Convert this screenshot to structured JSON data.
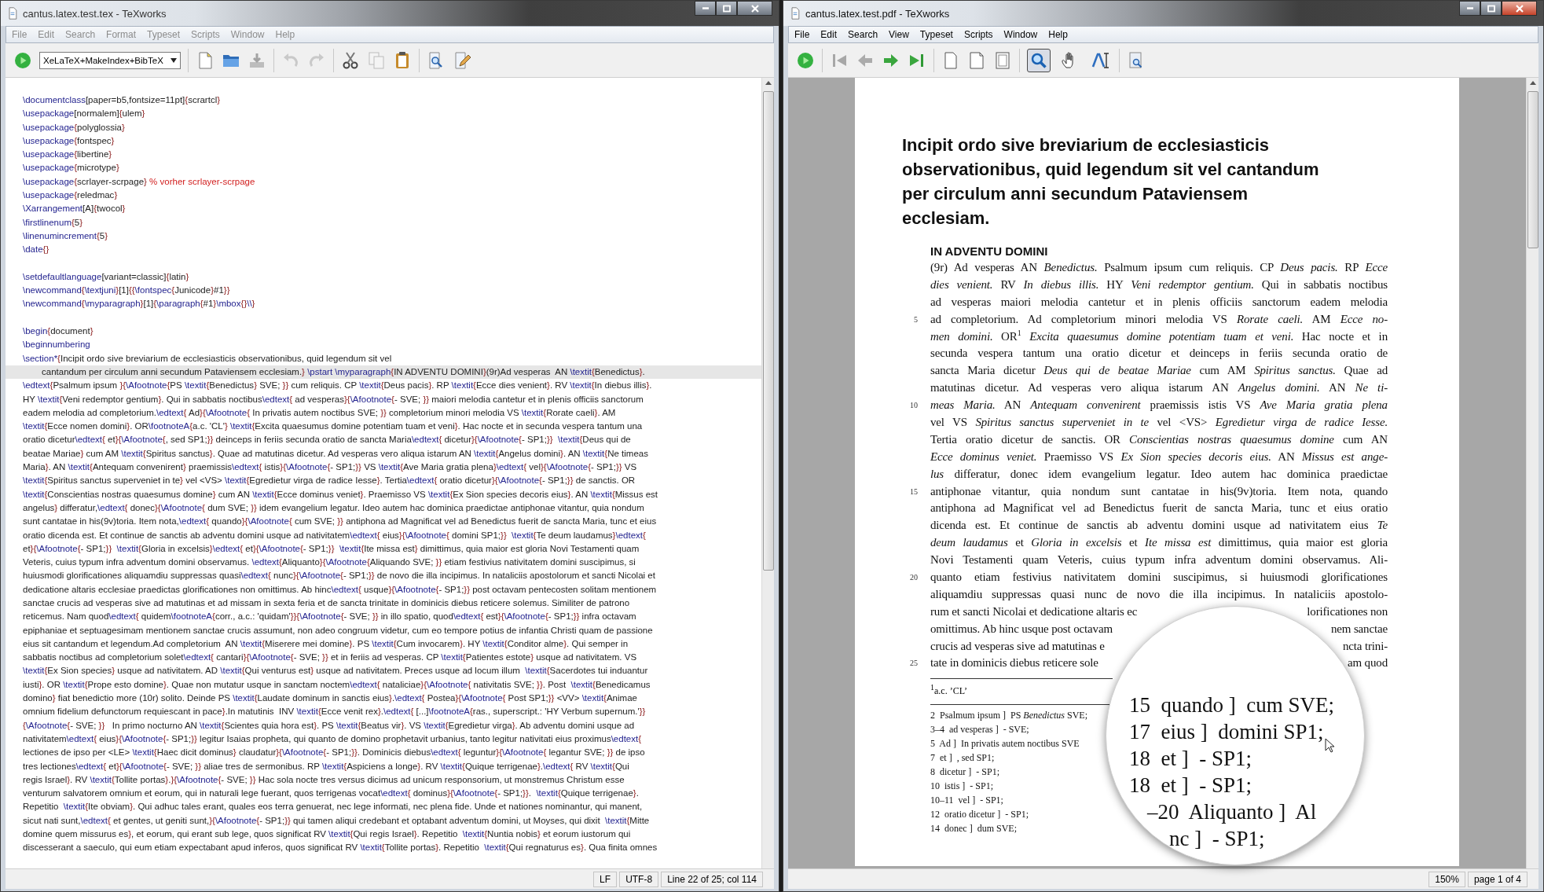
{
  "editor_window": {
    "title": "cantus.latex.test.tex - TeXworks",
    "active": false,
    "menu": [
      "File",
      "Edit",
      "Search",
      "Format",
      "Typeset",
      "Scripts",
      "Window",
      "Help"
    ],
    "typeset_engine": "XeLaTeX+MakeIndex+BibTeX",
    "blocks": [
      {
        "rows": [
          {
            "kind": "line",
            "current": false,
            "text": "\\documentclass[paper=b5,fontsize=11pt]{scrartcl}"
          },
          {
            "kind": "line",
            "current": false,
            "text": "\\usepackage[normalem]{ulem}"
          },
          {
            "kind": "line",
            "current": false,
            "text": "\\usepackage{polyglossia}"
          },
          {
            "kind": "line",
            "current": false,
            "text": "\\usepackage{fontspec}"
          },
          {
            "kind": "line",
            "current": false,
            "text": "\\usepackage{libertine}"
          },
          {
            "kind": "line",
            "current": false,
            "text": "\\usepackage{microtype}"
          },
          {
            "kind": "line",
            "current": false,
            "text": "\\usepackage{scrlayer-scrpage} % vorher scrlayer-scrpage"
          },
          {
            "kind": "line",
            "current": false,
            "text": "\\usepackage{reledmac}"
          },
          {
            "kind": "line",
            "current": false,
            "text": "\\Xarrangement[A]{twocol}"
          },
          {
            "kind": "line",
            "current": false,
            "text": "\\firstlinenum{5}"
          },
          {
            "kind": "line",
            "current": false,
            "text": "\\linenumincrement{5}"
          },
          {
            "kind": "line",
            "current": false,
            "text": "\\date{}"
          }
        ]
      },
      {
        "rows": [
          {
            "kind": "line",
            "current": false,
            "text": "\\setdefaultlanguage[variant=classic]{latin}"
          },
          {
            "kind": "line",
            "current": false,
            "text": "\\newcommand{\\textjuni}[1]{{\\fontspec{Junicode}#1}}"
          },
          {
            "kind": "line",
            "current": false,
            "text": "\\newcommand{\\myparagraph}[1]{\\paragraph{#1}\\mbox{}\\\\}"
          }
        ]
      },
      {
        "rows": [
          {
            "kind": "line",
            "current": false,
            "text": "\\begin{document}"
          },
          {
            "kind": "line",
            "current": false,
            "text": "\\beginnumbering"
          },
          {
            "kind": "line",
            "current": false,
            "text": "\\section*{Incipit ordo sive breviarium de ecclesiasticis observationibus, quid legendum sit vel"
          },
          {
            "kind": "wrap",
            "current": true,
            "text": "cantandum per circulum anni secundum Pataviensem ecclesiam.} \\pstart \\myparagraph{IN ADVENTU DOMINI}(9r)Ad vesperas  AN \\textit{Benedictus}."
          },
          {
            "kind": "line",
            "current": false,
            "text": "\\edtext{Psalmum ipsum }{\\Afootnote{PS \\textit{Benedictus} SVE; }} cum reliquis. CP \\textit{Deus pacis}. RP \\textit{Ecce dies venient}. RV \\textit{In diebus illis}."
          },
          {
            "kind": "line",
            "current": false,
            "text": "HY \\textit{Veni redemptor gentium}. Qui in sabbatis noctibus\\edtext{ ad vesperas}{\\Afootnote{- SVE; }} maiori melodia cantetur et in plenis officiis sanctorum"
          },
          {
            "kind": "line",
            "current": false,
            "text": "eadem melodia ad completorium.\\edtext{ Ad}{\\Afootnote{ In privatis autem noctibus SVE; }} completorium minori melodia VS \\textit{Rorate caeli}. AM"
          },
          {
            "kind": "line",
            "current": false,
            "text": "\\textit{Ecce nomen domini}. OR\\footnoteA{a.c. 'CL'} \\textit{Excita quaesumus domine potentiam tuam et veni}. Hac nocte et in secunda vespera tantum una"
          },
          {
            "kind": "line",
            "current": false,
            "text": "oratio dicetur\\edtext{ et}{\\Afootnote{, sed SP1;}} deinceps in feriis secunda oratio de sancta Maria\\edtext{ dicetur}{\\Afootnote{- SP1;}}  \\textit{Deus qui de"
          },
          {
            "kind": "line",
            "current": false,
            "text": "beatae Mariae} cum AM \\textit{Spiritus sanctus}. Quae ad matutinas dicetur. Ad vesperas vero aliqua istarum AN \\textit{Angelus domini}. AN \\textit{Ne timeas"
          },
          {
            "kind": "line",
            "current": false,
            "text": "Maria}. AN \\textit{Antequam convenirent} praemissis\\edtext{ istis}{\\Afootnote{- SP1;}} VS \\textit{Ave Maria gratia plena}\\edtext{ vel}{\\Afootnote{- SP1;}} VS"
          },
          {
            "kind": "line",
            "current": false,
            "text": "\\textit{Spiritus sanctus superveniet in te} vel <VS> \\textit{Egredietur virga de radice Iesse}. Tertia\\edtext{ oratio dicetur}{\\Afootnote{- SP1;}} de sanctis. OR"
          },
          {
            "kind": "line",
            "current": false,
            "text": "\\textit{Conscientias nostras quaesumus domine} cum AN \\textit{Ecce dominus veniet}. Praemisso VS \\textit{Ex Sion species decoris eius}. AN \\textit{Missus est"
          },
          {
            "kind": "line",
            "current": false,
            "text": "angelus} differatur,\\edtext{ donec}{\\Afootnote{ dum SVE; }} idem evangelium legatur. Ideo autem hac dominica praedictae antiphonae vitantur, quia nondum"
          },
          {
            "kind": "line",
            "current": false,
            "text": "sunt cantatae in his(9v)toria. Item nota,\\edtext{ quando}{\\Afootnote{ cum SVE; }} antiphona ad Magnificat vel ad Benedictus fuerit de sancta Maria, tunc et eius"
          },
          {
            "kind": "line",
            "current": false,
            "text": "oratio dicenda est. Et continue de sanctis ab adventu domini usque ad nativitatem\\edtext{ eius}{\\Afootnote{ domini SP1;}}  \\textit{Te deum laudamus}\\edtext{"
          },
          {
            "kind": "line",
            "current": false,
            "text": "et}{\\Afootnote{- SP1;}}  \\textit{Gloria in excelsis}\\edtext{ et}{\\Afootnote{- SP1;}}  \\textit{Ite missa est} dimittimus, quia maior est gloria Novi Testamenti quam"
          },
          {
            "kind": "line",
            "current": false,
            "text": "Veteris, cuius typum infra adventum domini observamus. \\edtext{Aliquanto}{\\Afootnote{Aliquando SVE; }} etiam festivius nativitatem domini suscipimus, si"
          },
          {
            "kind": "line",
            "current": false,
            "text": "huiusmodi glorificationes aliquamdiu suppressas quasi\\edtext{ nunc}{\\Afootnote{- SP1;}} de novo die illa incipimus. In nataliciis apostolorum et sancti Nicolai et"
          },
          {
            "kind": "line",
            "current": false,
            "text": "dedicatione altaris ecclesiae praedictas glorificationes non omittimus. Ab hinc\\edtext{ usque}{\\Afootnote{- SP1;}} post octavam pentecosten solitam mentionem"
          },
          {
            "kind": "line",
            "current": false,
            "text": "sanctae crucis ad vesperas sive ad matutinas et ad missam in sexta feria et de sancta trinitate in dominicis diebus reticere solemus. Similiter de patrono"
          },
          {
            "kind": "line",
            "current": false,
            "text": "reticemus. Nam quod\\edtext{ quidem\\footnoteA{corr., a.c.: 'quidam'}}{\\Afootnote{- SVE; }} in illo spatio, quod\\edtext{ est}{\\Afootnote{- SP1;}} infra octavam"
          },
          {
            "kind": "line",
            "current": false,
            "text": "epiphaniae et septuagesimam mentionem sanctae crucis assumunt, non adeo congruum videtur, cum eo tempore potius de infantia Christi quam de passione"
          },
          {
            "kind": "line",
            "current": false,
            "text": "eius sit cantandum et legendum.Ad completorium  AN \\textit{Miserere mei domine}. PS \\textit{Cum invocarem}. HY \\textit{Conditor alme}. Qui semper in"
          },
          {
            "kind": "line",
            "current": false,
            "text": "sabbatis noctibus ad completorium solet\\edtext{ cantari}{\\Afootnote{- SVE; }} et in feriis ad vesperas. CP \\textit{Patientes estote} usque ad nativitatem. VS"
          },
          {
            "kind": "line",
            "current": false,
            "text": "\\textit{Ex Sion species} usque ad nativitatem. AD \\textit{Qui venturus est} usque ad nativitatem. Preces usque ad locum illum  \\textit{Sacerdotes tui induantur"
          },
          {
            "kind": "line",
            "current": false,
            "text": "iusti}. OR \\textit{Prope esto domine}. Quae non mutatur usque in sanctam noctem\\edtext{ nataliciae}{\\Afootnote{ nativitatis SVE; }}. Post  \\textit{Benedicamus"
          },
          {
            "kind": "line",
            "current": false,
            "text": "domino} fiat benedictio more (10r) solito. Deinde PS \\textit{Laudate dominum in sanctis eius}.\\edtext{ Postea}{\\Afootnote{ Post SP1;}} <VV> \\textit{Animae"
          },
          {
            "kind": "line",
            "current": false,
            "text": "omnium fidelium defunctorum requiescant in pace}.In matutinis  INV \\textit{Ecce venit rex}.\\edtext{ [...]\\footnoteA{ras., superscript.: 'HY Verbum supernum.'}}"
          },
          {
            "kind": "line",
            "current": false,
            "text": "{\\Afootnote{- SVE; }}   In primo nocturno AN \\textit{Scientes quia hora est}. PS \\textit{Beatus vir}. VS \\textit{Egredietur virga}. Ab adventu domini usque ad"
          },
          {
            "kind": "line",
            "current": false,
            "text": "nativitatem\\edtext{ eius}{\\Afootnote{- SP1;}} legitur Isaias propheta, qui quanto de domino prophetavit urbanius, tanto legitur nativitati eius proximus\\edtext{"
          },
          {
            "kind": "line",
            "current": false,
            "text": "lectiones de ipso per <LE> \\textit{Haec dicit dominus} claudatur}{\\Afootnote{- SP1;}}. Dominicis diebus\\edtext{ leguntur}{\\Afootnote{ legantur SVE; }} de ipso"
          },
          {
            "kind": "line",
            "current": false,
            "text": "tres lectiones\\edtext{ et}{\\Afootnote{- SVE; }} aliae tres de sermonibus. RP \\textit{Aspiciens a longe}. RV \\textit{Quique terrigenae}.\\edtext{ RV \\textit{Qui"
          },
          {
            "kind": "line",
            "current": false,
            "text": "regis Israel}. RV \\textit{Tollite portas}.}{\\Afootnote{- SVE; }} Hac sola nocte tres versus dicimus ad unicum responsorium, ut monstremus Christum esse"
          },
          {
            "kind": "line",
            "current": false,
            "text": "venturum salvatorem omnium et eorum, qui in naturali lege fuerant, quos terrigenas vocat\\edtext{ dominus}{\\Afootnote{- SP1;}}.  \\textit{Quique terrigenae}."
          },
          {
            "kind": "line",
            "current": false,
            "text": "Repetitio  \\textit{Ite obviam}. Qui adhuc tales erant, quales eos terra genuerat, nec lege informati, nec plena fide. Unde et nationes nominantur, qui manent,"
          },
          {
            "kind": "line",
            "current": false,
            "text": "sicut nati sunt,\\edtext{ et gentes, ut geniti sunt,}{\\Afootnote{- SP1;}} qui tamen aliqui credebant et optabant adventum domini, ut Moyses, qui dixit  \\textit{Mitte"
          },
          {
            "kind": "line",
            "current": false,
            "text": "domine quem missurus es}, et eorum, qui erant sub lege, quos significat RV \\textit{Qui regis Israel}. Repetitio  \\textit{Nuntia nobis} et eorum iustorum qui"
          },
          {
            "kind": "line",
            "current": false,
            "text": "discesserant a saeculo, qui eum etiam expectabant apud inferos, quos significat RV \\textit{Tollite portas}. Repetitio  \\textit{Qui regnaturus es}. Qua finita omnes"
          }
        ]
      }
    ],
    "status_bar": [
      "LF",
      "UTF-8",
      "Line 22 of 25; col 114"
    ]
  },
  "pdf_window": {
    "title": "cantus.latex.test.pdf - TeXworks",
    "active": true,
    "menu": [
      "File",
      "Edit",
      "Search",
      "View",
      "Typeset",
      "Scripts",
      "Window",
      "Help"
    ],
    "tools": [
      {
        "selected": true
      },
      {
        "selected": false
      },
      {
        "selected": false
      }
    ],
    "page": {
      "title_lines": [
        "Incipit ordo sive breviarium de ecclesiasticis",
        "observationibus, quid legendum sit vel cantandum",
        "per circulum anni secundum Pataviensem",
        "ecclesiam."
      ],
      "section_heading": "IN ADVENTU DOMINI",
      "lines": [
        {
          "kind": "full",
          "text": "(9r) Ad vesperas AN *Benedictus.* Psalmum ipsum cum reliquis. CP *Deus pacis.* RP *Ecce*"
        },
        {
          "kind": "full",
          "text": "*dies venient.* RV *In diebus illis.* HY *Veni redemptor gentium.* Qui in sabbatis noctibus"
        },
        {
          "kind": "full",
          "text": "ad vesperas maiori melodia cantetur et in plenis officiis sanctorum eadem melodia"
        },
        {
          "kind": "full",
          "number": "5",
          "text": "ad completorium. Ad completorium minori melodia VS *Rorate caeli.* AM *Ecce no-*"
        },
        {
          "kind": "full",
          "text": "*men domini.* OR$^{1}$ *Excita quaesumus domine potentiam tuam et veni.* Hac nocte et in"
        },
        {
          "kind": "full",
          "text": "secunda vespera tantum una oratio dicetur et deinceps in feriis secunda oratio de"
        },
        {
          "kind": "full",
          "text": "sancta Maria dicetur *Deus qui de beatae Mariae* cum AM *Spiritus sanctus.* Quae ad"
        },
        {
          "kind": "full",
          "text": "matutinas dicetur. Ad vesperas vero aliqua istarum AN *Angelus domini.* AN *Ne ti-*"
        },
        {
          "kind": "full",
          "number": "10",
          "text": "*meas Maria.* AN *Antequam convenirent* praemissis istis VS *Ave Maria gratia plena*"
        },
        {
          "kind": "full",
          "text": "vel VS *Spiritus sanctus superveniet in te* vel <VS> *Egredietur virga de radice Iesse.*"
        },
        {
          "kind": "full",
          "text": "Tertia oratio dicetur de sanctis. OR *Conscientias nostras quaesumus domine* cum AN"
        },
        {
          "kind": "full",
          "text": "*Ecce dominus veniet.* Praemisso VS *Ex Sion species decoris eius.* AN *Missus est ange-*"
        },
        {
          "kind": "full",
          "text": "*lus* differatur, donec idem evangelium legatur. Ideo autem hac dominica praedictae"
        },
        {
          "kind": "full",
          "number": "15",
          "text": "antiphonae vitantur, quia nondum sunt cantatae in his(9v)toria. Item nota, quando"
        },
        {
          "kind": "full",
          "text": "antiphona ad Magnificat vel ad Benedictus fuerit de sancta Maria, tunc et eius oratio"
        },
        {
          "kind": "full",
          "text": "dicenda est. Et continue de sanctis ab adventu domini usque ad nativitatem eius *Te*"
        },
        {
          "kind": "full",
          "text": "*deum laudamus* et *Gloria in excelsis* et *Ite missa est* dimittimus, quia maior est gloria"
        },
        {
          "kind": "full",
          "text": "Novi Testamenti quam Veteris, cuius typum infra adventum domini observamus. Ali-"
        },
        {
          "kind": "full",
          "number": "20",
          "text": "quanto etiam festivius nativitatem domini suscipimus, si huiusmodi glorificationes"
        },
        {
          "kind": "full",
          "text": "aliquamdiu suppressas quasi nunc de novo die illa incipimus. In nataliciis apostolo-"
        },
        {
          "kind": "split",
          "left": "rum et sancti Nicolai et dedicatione altaris ec",
          "right": "lorificationes non"
        },
        {
          "kind": "split",
          "left": "omittimus. Ab hinc usque post octavam",
          "right": "nem sanctae"
        },
        {
          "kind": "split",
          "left": "crucis ad vesperas sive ad matutinas e",
          "right": "ncta trini-"
        },
        {
          "kind": "split",
          "number": "25",
          "left": "tate in dominicis diebus reticere sole",
          "right": "am quod"
        }
      ],
      "footnote": "$^{1}$a.c. ’CL’",
      "apparatus": [
        "2  Psalmum ipsum ]  PS *Benedictus* SVE;",
        "3–4  ad vesperas ]  - SVE;",
        "5  Ad ]  In privatis autem noctibus SVE",
        "7  et ]  , sed SP1;",
        "8  dicetur ]  - SP1;",
        "10  istis ]  - SP1;",
        "10–11  vel ]  - SP1;",
        "12  oratio dicetur ]  - SP1;",
        "14  donec ]  dum SVE;"
      ],
      "magnifier": {
        "lines": [
          "15  quando ]  cum SVE;",
          "17  eius ]  domini SP1;",
          "18  et ]  - SP1;",
          "18  et ]  - SP1;",
          "–20  Aliquanto ]  Al",
          "nc ]  - SP1;"
        ]
      }
    },
    "status_bar": [
      "150%",
      "page 1 of 4"
    ]
  }
}
